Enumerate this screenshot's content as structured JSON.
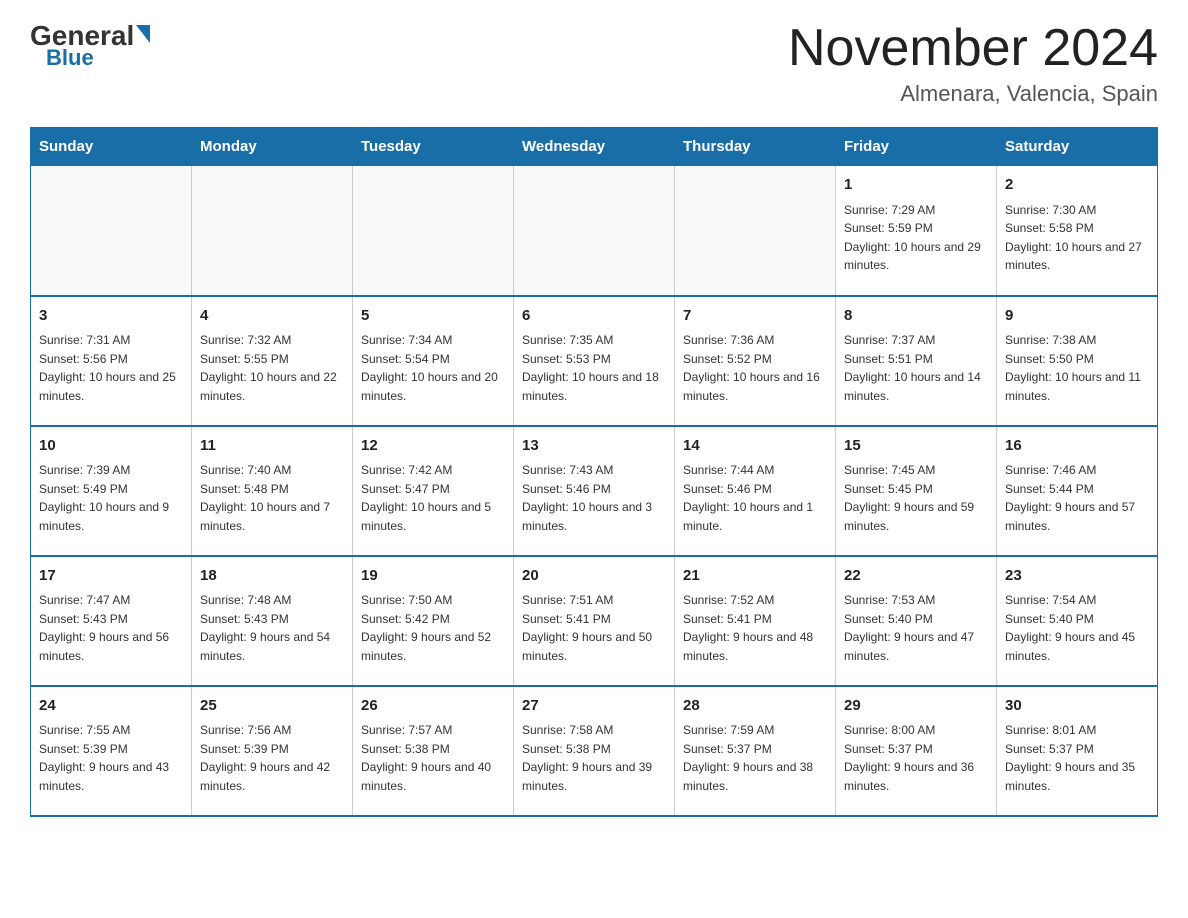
{
  "header": {
    "logo_general": "General",
    "logo_blue": "Blue",
    "month_title": "November 2024",
    "location": "Almenara, Valencia, Spain"
  },
  "weekdays": [
    "Sunday",
    "Monday",
    "Tuesday",
    "Wednesday",
    "Thursday",
    "Friday",
    "Saturday"
  ],
  "weeks": [
    [
      {
        "day": "",
        "info": ""
      },
      {
        "day": "",
        "info": ""
      },
      {
        "day": "",
        "info": ""
      },
      {
        "day": "",
        "info": ""
      },
      {
        "day": "",
        "info": ""
      },
      {
        "day": "1",
        "info": "Sunrise: 7:29 AM\nSunset: 5:59 PM\nDaylight: 10 hours and 29 minutes."
      },
      {
        "day": "2",
        "info": "Sunrise: 7:30 AM\nSunset: 5:58 PM\nDaylight: 10 hours and 27 minutes."
      }
    ],
    [
      {
        "day": "3",
        "info": "Sunrise: 7:31 AM\nSunset: 5:56 PM\nDaylight: 10 hours and 25 minutes."
      },
      {
        "day": "4",
        "info": "Sunrise: 7:32 AM\nSunset: 5:55 PM\nDaylight: 10 hours and 22 minutes."
      },
      {
        "day": "5",
        "info": "Sunrise: 7:34 AM\nSunset: 5:54 PM\nDaylight: 10 hours and 20 minutes."
      },
      {
        "day": "6",
        "info": "Sunrise: 7:35 AM\nSunset: 5:53 PM\nDaylight: 10 hours and 18 minutes."
      },
      {
        "day": "7",
        "info": "Sunrise: 7:36 AM\nSunset: 5:52 PM\nDaylight: 10 hours and 16 minutes."
      },
      {
        "day": "8",
        "info": "Sunrise: 7:37 AM\nSunset: 5:51 PM\nDaylight: 10 hours and 14 minutes."
      },
      {
        "day": "9",
        "info": "Sunrise: 7:38 AM\nSunset: 5:50 PM\nDaylight: 10 hours and 11 minutes."
      }
    ],
    [
      {
        "day": "10",
        "info": "Sunrise: 7:39 AM\nSunset: 5:49 PM\nDaylight: 10 hours and 9 minutes."
      },
      {
        "day": "11",
        "info": "Sunrise: 7:40 AM\nSunset: 5:48 PM\nDaylight: 10 hours and 7 minutes."
      },
      {
        "day": "12",
        "info": "Sunrise: 7:42 AM\nSunset: 5:47 PM\nDaylight: 10 hours and 5 minutes."
      },
      {
        "day": "13",
        "info": "Sunrise: 7:43 AM\nSunset: 5:46 PM\nDaylight: 10 hours and 3 minutes."
      },
      {
        "day": "14",
        "info": "Sunrise: 7:44 AM\nSunset: 5:46 PM\nDaylight: 10 hours and 1 minute."
      },
      {
        "day": "15",
        "info": "Sunrise: 7:45 AM\nSunset: 5:45 PM\nDaylight: 9 hours and 59 minutes."
      },
      {
        "day": "16",
        "info": "Sunrise: 7:46 AM\nSunset: 5:44 PM\nDaylight: 9 hours and 57 minutes."
      }
    ],
    [
      {
        "day": "17",
        "info": "Sunrise: 7:47 AM\nSunset: 5:43 PM\nDaylight: 9 hours and 56 minutes."
      },
      {
        "day": "18",
        "info": "Sunrise: 7:48 AM\nSunset: 5:43 PM\nDaylight: 9 hours and 54 minutes."
      },
      {
        "day": "19",
        "info": "Sunrise: 7:50 AM\nSunset: 5:42 PM\nDaylight: 9 hours and 52 minutes."
      },
      {
        "day": "20",
        "info": "Sunrise: 7:51 AM\nSunset: 5:41 PM\nDaylight: 9 hours and 50 minutes."
      },
      {
        "day": "21",
        "info": "Sunrise: 7:52 AM\nSunset: 5:41 PM\nDaylight: 9 hours and 48 minutes."
      },
      {
        "day": "22",
        "info": "Sunrise: 7:53 AM\nSunset: 5:40 PM\nDaylight: 9 hours and 47 minutes."
      },
      {
        "day": "23",
        "info": "Sunrise: 7:54 AM\nSunset: 5:40 PM\nDaylight: 9 hours and 45 minutes."
      }
    ],
    [
      {
        "day": "24",
        "info": "Sunrise: 7:55 AM\nSunset: 5:39 PM\nDaylight: 9 hours and 43 minutes."
      },
      {
        "day": "25",
        "info": "Sunrise: 7:56 AM\nSunset: 5:39 PM\nDaylight: 9 hours and 42 minutes."
      },
      {
        "day": "26",
        "info": "Sunrise: 7:57 AM\nSunset: 5:38 PM\nDaylight: 9 hours and 40 minutes."
      },
      {
        "day": "27",
        "info": "Sunrise: 7:58 AM\nSunset: 5:38 PM\nDaylight: 9 hours and 39 minutes."
      },
      {
        "day": "28",
        "info": "Sunrise: 7:59 AM\nSunset: 5:37 PM\nDaylight: 9 hours and 38 minutes."
      },
      {
        "day": "29",
        "info": "Sunrise: 8:00 AM\nSunset: 5:37 PM\nDaylight: 9 hours and 36 minutes."
      },
      {
        "day": "30",
        "info": "Sunrise: 8:01 AM\nSunset: 5:37 PM\nDaylight: 9 hours and 35 minutes."
      }
    ]
  ]
}
